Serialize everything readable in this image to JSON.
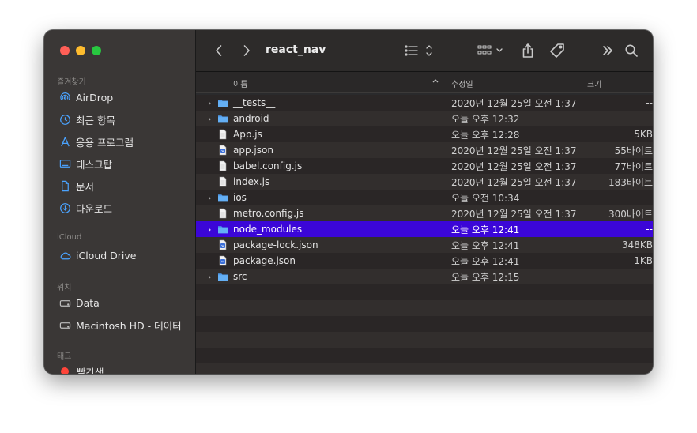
{
  "window": {
    "title": "react_nav"
  },
  "sidebar": {
    "favorites_label": "즐겨찾기",
    "favorites": [
      {
        "label": "AirDrop",
        "icon": "airdrop-icon"
      },
      {
        "label": "최근 항목",
        "icon": "clock-icon"
      },
      {
        "label": "응용 프로그램",
        "icon": "applications-icon"
      },
      {
        "label": "데스크탑",
        "icon": "desktop-icon"
      },
      {
        "label": "문서",
        "icon": "document-icon"
      },
      {
        "label": "다운로드",
        "icon": "download-icon"
      }
    ],
    "icloud_label": "iCloud",
    "icloud": [
      {
        "label": "iCloud Drive",
        "icon": "cloud-icon"
      }
    ],
    "locations_label": "위치",
    "locations": [
      {
        "label": "Data",
        "icon": "disk-icon"
      },
      {
        "label": "Macintosh HD - 데이터",
        "icon": "disk-icon"
      }
    ],
    "tags_label": "태그",
    "tags": [
      {
        "label": "빨간색",
        "color": "#ff453a"
      }
    ]
  },
  "columns": {
    "name": "이름",
    "modified": "수정일",
    "size": "크기"
  },
  "files": [
    {
      "name": "__tests__",
      "type": "folder",
      "modified": "2020년 12월 25일 오전 1:37",
      "size": "--"
    },
    {
      "name": "android",
      "type": "folder",
      "modified": "오늘 오후 12:32",
      "size": "--"
    },
    {
      "name": "App.js",
      "type": "file",
      "modified": "오늘 오후 12:28",
      "size": "5KB"
    },
    {
      "name": "app.json",
      "type": "json",
      "modified": "2020년 12월 25일 오전 1:37",
      "size": "55바이트"
    },
    {
      "name": "babel.config.js",
      "type": "file",
      "modified": "2020년 12월 25일 오전 1:37",
      "size": "77바이트"
    },
    {
      "name": "index.js",
      "type": "file",
      "modified": "2020년 12월 25일 오전 1:37",
      "size": "183바이트"
    },
    {
      "name": "ios",
      "type": "folder",
      "modified": "오늘 오전 10:34",
      "size": "--"
    },
    {
      "name": "metro.config.js",
      "type": "file",
      "modified": "2020년 12월 25일 오전 1:37",
      "size": "300바이트"
    },
    {
      "name": "node_modules",
      "type": "folder",
      "modified": "오늘 오후 12:41",
      "size": "--",
      "selected": true
    },
    {
      "name": "package-lock.json",
      "type": "json",
      "modified": "오늘 오후 12:41",
      "size": "348KB"
    },
    {
      "name": "package.json",
      "type": "json",
      "modified": "오늘 오후 12:41",
      "size": "1KB"
    },
    {
      "name": "src",
      "type": "folder",
      "modified": "오늘 오후 12:15",
      "size": "--"
    }
  ],
  "colors": {
    "accent": "#3b06d8",
    "folder": "#58a6f0",
    "sidebar_icon": "#4aa3ff"
  }
}
